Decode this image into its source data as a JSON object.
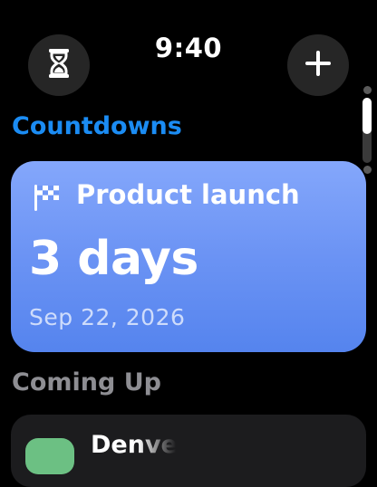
{
  "status": {
    "time": "9:40"
  },
  "toolbar": {
    "left_icon": "hourglass-icon",
    "right_icon": "plus-icon"
  },
  "countdowns": {
    "section_title": "Countdowns",
    "featured": {
      "icon": "checkered-flag-icon",
      "title": "Product launch",
      "value": "3 days",
      "date": "Sep 22, 2026",
      "colors": {
        "gradient_top": "#84a7fb",
        "gradient_bottom": "#5584ee"
      }
    }
  },
  "coming_up": {
    "section_title": "Coming Up",
    "items": [
      {
        "label": "Denve",
        "icon_color": "#6cc083"
      }
    ]
  },
  "colors": {
    "accent": "#1b8cf3",
    "secondary_text": "#8e8e93",
    "background": "#000000"
  }
}
